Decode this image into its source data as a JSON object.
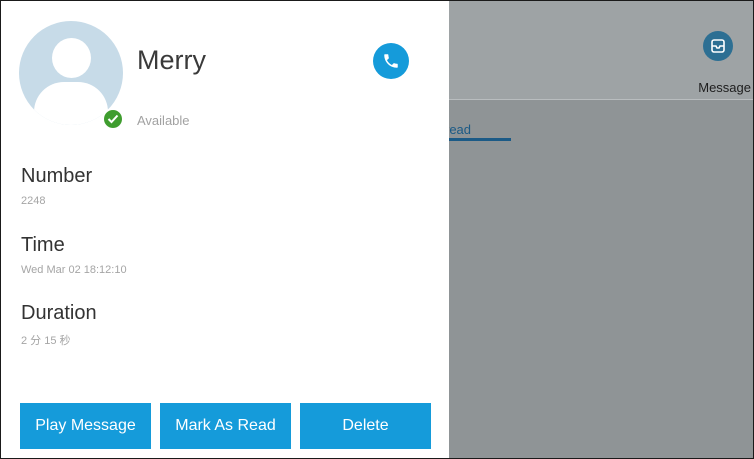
{
  "contact": {
    "name": "Merry",
    "status": "Available"
  },
  "details": [
    {
      "label": "Number",
      "value": "2248"
    },
    {
      "label": "Time",
      "value": "Wed Mar 02 18:12:10"
    },
    {
      "label": "Duration",
      "value": "2 分 15 秒"
    }
  ],
  "actions": {
    "play": "Play Message",
    "mark_read": "Mark As Read",
    "delete": "Delete"
  },
  "background": {
    "message_label": "Message",
    "tab_label": "read"
  },
  "colors": {
    "accent": "#159bda",
    "status_green": "#3f9d2f",
    "overlay": "#8f9496"
  },
  "icons": {
    "call": "phone-icon",
    "status": "check-icon",
    "message": "inbox-icon"
  }
}
